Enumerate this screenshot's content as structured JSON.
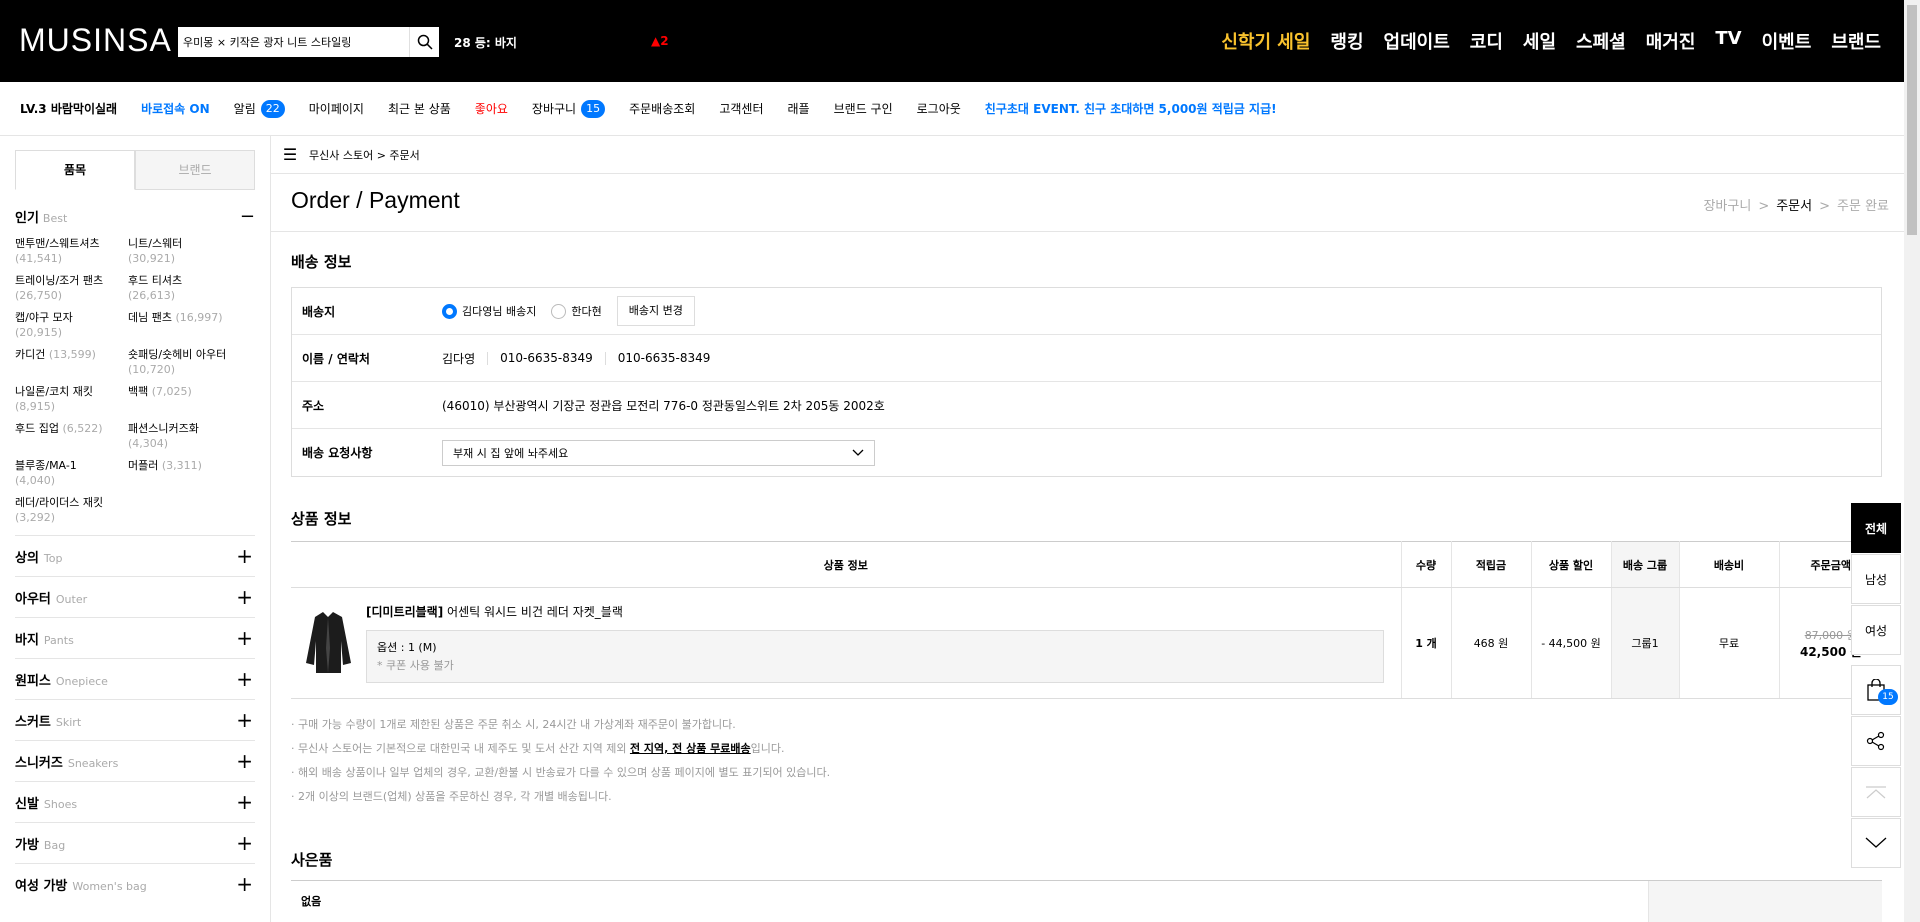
{
  "header": {
    "logo": "MUSINSA",
    "search_value": "우미몽 × 키작은 광자 니트 스타일링",
    "rank": "28 등: 바지",
    "rank_change": "▲2",
    "menu": [
      "신학기 세일",
      "랭킹",
      "업데이트",
      "코디",
      "세일",
      "스페셜",
      "매거진",
      "TV",
      "이벤트",
      "브랜드"
    ]
  },
  "util": {
    "level": "LV.3 바람막이실래",
    "quick": "바로접속 ON",
    "alarm": "알림",
    "alarm_count": "22",
    "mypage": "마이페이지",
    "recent": "최근 본 상품",
    "like": "좋아요",
    "cart": "장바구니",
    "cart_count": "15",
    "order": "주문배송조회",
    "cs": "고객센터",
    "raffle": "래플",
    "brand_buy": "브랜드 구인",
    "logout": "로그아웃",
    "event": "친구초대 EVENT. 친구 초대하면 5,000원 적립금 지급!"
  },
  "sidebar": {
    "tab_item": "품목",
    "tab_brand": "브랜드",
    "best_label": "인기",
    "best_en": "Best",
    "best_items": [
      {
        "name": "맨투맨/스웨트셔츠",
        "count": "(41,541)"
      },
      {
        "name": "니트/스웨터",
        "count": "(30,921)"
      },
      {
        "name": "트레이닝/조거 팬츠",
        "count": "(26,750)"
      },
      {
        "name": "후드 티셔츠",
        "count": "(26,613)"
      },
      {
        "name": "캡/야구 모자",
        "count": "(20,915)"
      },
      {
        "name": "데님 팬츠",
        "count": "(16,997)"
      },
      {
        "name": "카디건",
        "count": "(13,599)"
      },
      {
        "name": "숏패딩/숏헤비 아우터",
        "count": "(10,720)"
      },
      {
        "name": "나일론/코치 재킷",
        "count": "(8,915)"
      },
      {
        "name": "백팩",
        "count": "(7,025)"
      },
      {
        "name": "후드 집업",
        "count": "(6,522)"
      },
      {
        "name": "패션스니커즈화",
        "count": "(4,304)"
      },
      {
        "name": "블루종/MA-1",
        "count": "(4,040)"
      },
      {
        "name": "머플러",
        "count": "(3,311)"
      },
      {
        "name": "레더/라이더스 재킷",
        "count": "(3,292)"
      }
    ],
    "categories": [
      {
        "ko": "상의",
        "en": "Top"
      },
      {
        "ko": "아우터",
        "en": "Outer"
      },
      {
        "ko": "바지",
        "en": "Pants"
      },
      {
        "ko": "원피스",
        "en": "Onepiece"
      },
      {
        "ko": "스커트",
        "en": "Skirt"
      },
      {
        "ko": "스니커즈",
        "en": "Sneakers"
      },
      {
        "ko": "신발",
        "en": "Shoes"
      },
      {
        "ko": "가방",
        "en": "Bag"
      },
      {
        "ko": "여성 가방",
        "en": "Women's bag"
      }
    ]
  },
  "main": {
    "breadcrumb": "무신사 스토어 > 주문서",
    "title": "Order / Payment",
    "steps": [
      "장바구니",
      "주문서",
      "주문 완료"
    ],
    "shipping": {
      "heading": "배송 정보",
      "dest_label": "배송지",
      "radio1": "김다영님 배송지",
      "radio2": "한다현",
      "change_btn": "배송지 변경",
      "contact_label": "이름 / 연락처",
      "name": "김다영",
      "phone1": "010-6635-8349",
      "phone2": "010-6635-8349",
      "addr_label": "주소",
      "address": "(46010) 부산광역시 기장군 정관읍 모전리 776-0 정관동일스위트 2차 205동 2002호",
      "req_label": "배송 요청사항",
      "req_value": "부재 시 집 앞에 놔주세요"
    },
    "product": {
      "heading": "상품 정보",
      "columns": [
        "상품 정보",
        "수량",
        "적립금",
        "상품 할인",
        "배송 그룹",
        "배송비",
        "주문금액"
      ],
      "brand": "[디미트리블랙]",
      "name": "어센틱 워시드 비건 레더 자켓_블랙",
      "option": "옵션 : 1 (M)",
      "coupon": "* 쿠폰 사용 불가",
      "qty": "1 개",
      "point": "468 원",
      "discount": "- 44,500 원",
      "group": "그룹1",
      "fee": "무료",
      "orig_price": "87,000 원",
      "price": "42,500 원"
    },
    "notes": [
      "· 구매 가능 수량이 1개로 제한된 상품은 주문 취소 시, 24시간 내 가상계좌 재주문이 불가합니다.",
      "· 무신사 스토어는 기본적으로 대한민국 내 제주도 및 도서 산간 지역 제외",
      "전 지역, 전 상품 무료배송",
      "입니다.",
      "· 해외 배송 상품이나 일부 업체의 경우, 교환/환불 시 반송료가 다를 수 있으며 상품 페이지에 별도 표기되어 있습니다.",
      "· 2개 이상의 브랜드(업체) 상품을 주문하신 경우, 각 개별 배송됩니다."
    ],
    "gift": {
      "heading": "사은품",
      "value": "없음"
    }
  },
  "float": {
    "all": "전체",
    "men": "남성",
    "women": "여성",
    "cart_count": "15"
  }
}
